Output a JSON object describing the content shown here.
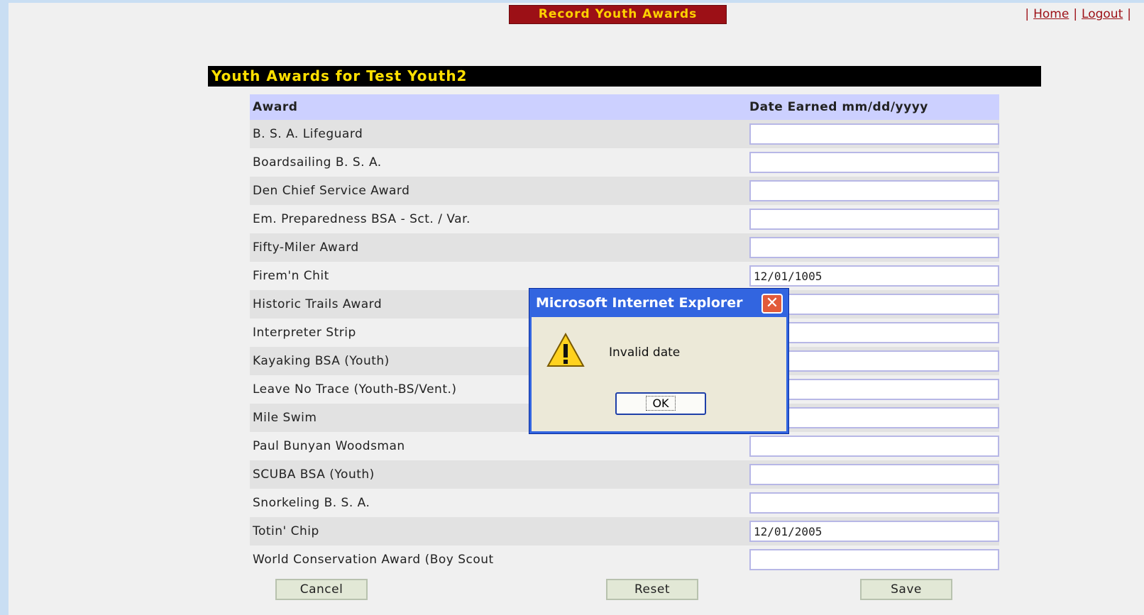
{
  "header": {
    "title": "Record Youth Awards",
    "links": [
      "Home",
      "Logout"
    ],
    "separator": "|"
  },
  "section_title": "Youth Awards for Test Youth2",
  "table": {
    "columns": [
      "Award",
      "Date Earned mm/dd/yyyy"
    ],
    "rows": [
      {
        "award": "B. S. A. Lifeguard",
        "date": ""
      },
      {
        "award": "Boardsailing B. S. A.",
        "date": ""
      },
      {
        "award": "Den Chief Service Award",
        "date": ""
      },
      {
        "award": "Em. Preparedness BSA - Sct. / Var.",
        "date": ""
      },
      {
        "award": "Fifty-Miler Award",
        "date": ""
      },
      {
        "award": "Firem'n Chit",
        "date": "12/01/1005"
      },
      {
        "award": "Historic Trails Award",
        "date": ""
      },
      {
        "award": "Interpreter Strip",
        "date": ""
      },
      {
        "award": "Kayaking BSA (Youth)",
        "date": ""
      },
      {
        "award": "Leave No Trace (Youth-BS/Vent.)",
        "date": ""
      },
      {
        "award": "Mile Swim",
        "date": ""
      },
      {
        "award": "Paul Bunyan Woodsman",
        "date": ""
      },
      {
        "award": "SCUBA BSA (Youth)",
        "date": ""
      },
      {
        "award": "Snorkeling B. S. A.",
        "date": ""
      },
      {
        "award": "Totin' Chip",
        "date": "12/01/2005"
      },
      {
        "award": "World Conservation Award (Boy Scout",
        "date": ""
      }
    ]
  },
  "buttons": {
    "cancel": "Cancel",
    "reset": "Reset",
    "save": "Save"
  },
  "dialog": {
    "title": "Microsoft Internet Explorer",
    "message": "Invalid date",
    "ok": "OK",
    "icon": "warning-icon"
  },
  "colors": {
    "header_bg": "#9c1016",
    "header_text": "#ffd200",
    "section_bg": "#000000",
    "section_text": "#ffe000",
    "table_header_bg": "#ccd0ff",
    "dialog_title_bg": "#3265e0"
  }
}
